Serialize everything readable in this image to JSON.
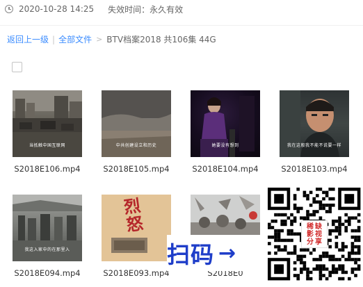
{
  "meta": {
    "date": "2020-10-28 14:25",
    "expire": "失效时间：永久有效"
  },
  "breadcrumb": {
    "back": "返回上一级",
    "sep": "|",
    "all_files": "全部文件",
    "arrow": ">",
    "current": "BTV档案2018 共106集 44G"
  },
  "files": [
    {
      "name": "S2018E106.mp4",
      "subtitle": "当抵触中国互联网"
    },
    {
      "name": "S2018E105.mp4",
      "subtitle": "中共创建设立和历史"
    },
    {
      "name": "S2018E104.mp4",
      "subtitle": "她要没有想到"
    },
    {
      "name": "S2018E103.mp4",
      "subtitle": "我在这般我不能不说要一样"
    },
    {
      "name": "S2018E094.mp4",
      "subtitle": "我这入家中的在那里入"
    },
    {
      "name": "S2018E093.mp4",
      "subtitle": "烈怒"
    },
    {
      "name": "S2018E0"
    }
  ],
  "banner": {
    "scan": "扫码",
    "arrow": "→"
  },
  "qr_badge": [
    "稀",
    "缺",
    "影",
    "视",
    "分",
    "享"
  ],
  "colors": {
    "link": "#3b8cff",
    "banner": "#1f3ec9",
    "badge": "#d12b2b"
  }
}
